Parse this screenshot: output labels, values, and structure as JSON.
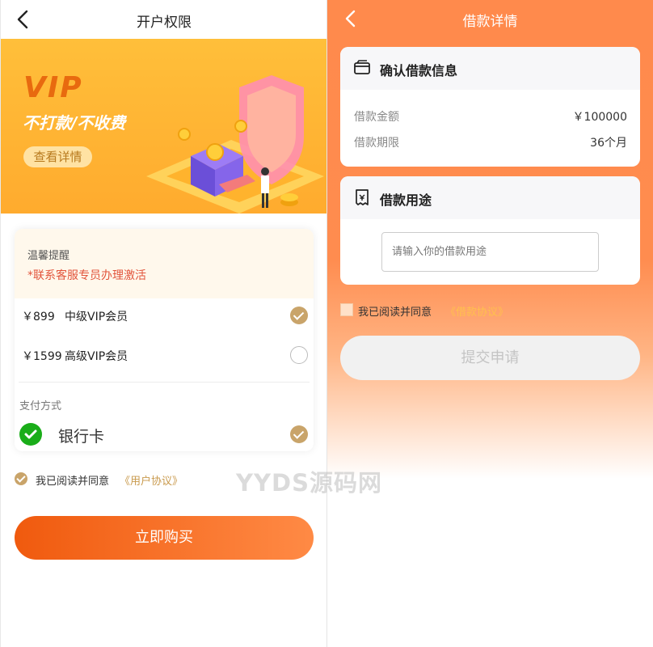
{
  "left": {
    "header": {
      "title": "开户权限",
      "back_icon": "back-arrow-icon"
    },
    "banner": {
      "vip_text": "VIP",
      "subtitle": "不打款/不收费",
      "details_button": "查看详情"
    },
    "notice": {
      "title": "温馨提醒",
      "text": "*联系客服专员办理激活"
    },
    "options": [
      {
        "price": "￥899",
        "name": "中级VIP会员",
        "selected": true
      },
      {
        "price": "￥1599",
        "name": "高级VIP会员",
        "selected": false
      }
    ],
    "payment": {
      "label": "支付方式",
      "method": "银行卡",
      "icon": "wechat-pay-icon",
      "selected": true
    },
    "agreement": {
      "text": "我已阅读并同意",
      "link": "《用户协议》"
    },
    "buy_button": "立即购买"
  },
  "watermark": "YYDS源码网",
  "right": {
    "header": {
      "title": "借款详情",
      "back_icon": "back-arrow-icon"
    },
    "confirm_card": {
      "title": "确认借款信息",
      "icon": "wallet-icon",
      "rows": [
        {
          "key": "借款金额",
          "value": "￥100000"
        },
        {
          "key": "借款期限",
          "value": "36个月"
        }
      ]
    },
    "purpose_card": {
      "title": "借款用途",
      "icon": "receipt-icon",
      "placeholder": "请输入你的借款用途",
      "value": ""
    },
    "agreement": {
      "text": "我已阅读并同意",
      "link": "《借款协议》"
    },
    "submit_button": "提交申请"
  },
  "colors": {
    "accent_orange": "#f05a0e",
    "gold": "#c9a46a",
    "notice_red": "#e2543b",
    "banner_yellow": "#ffb52e"
  }
}
